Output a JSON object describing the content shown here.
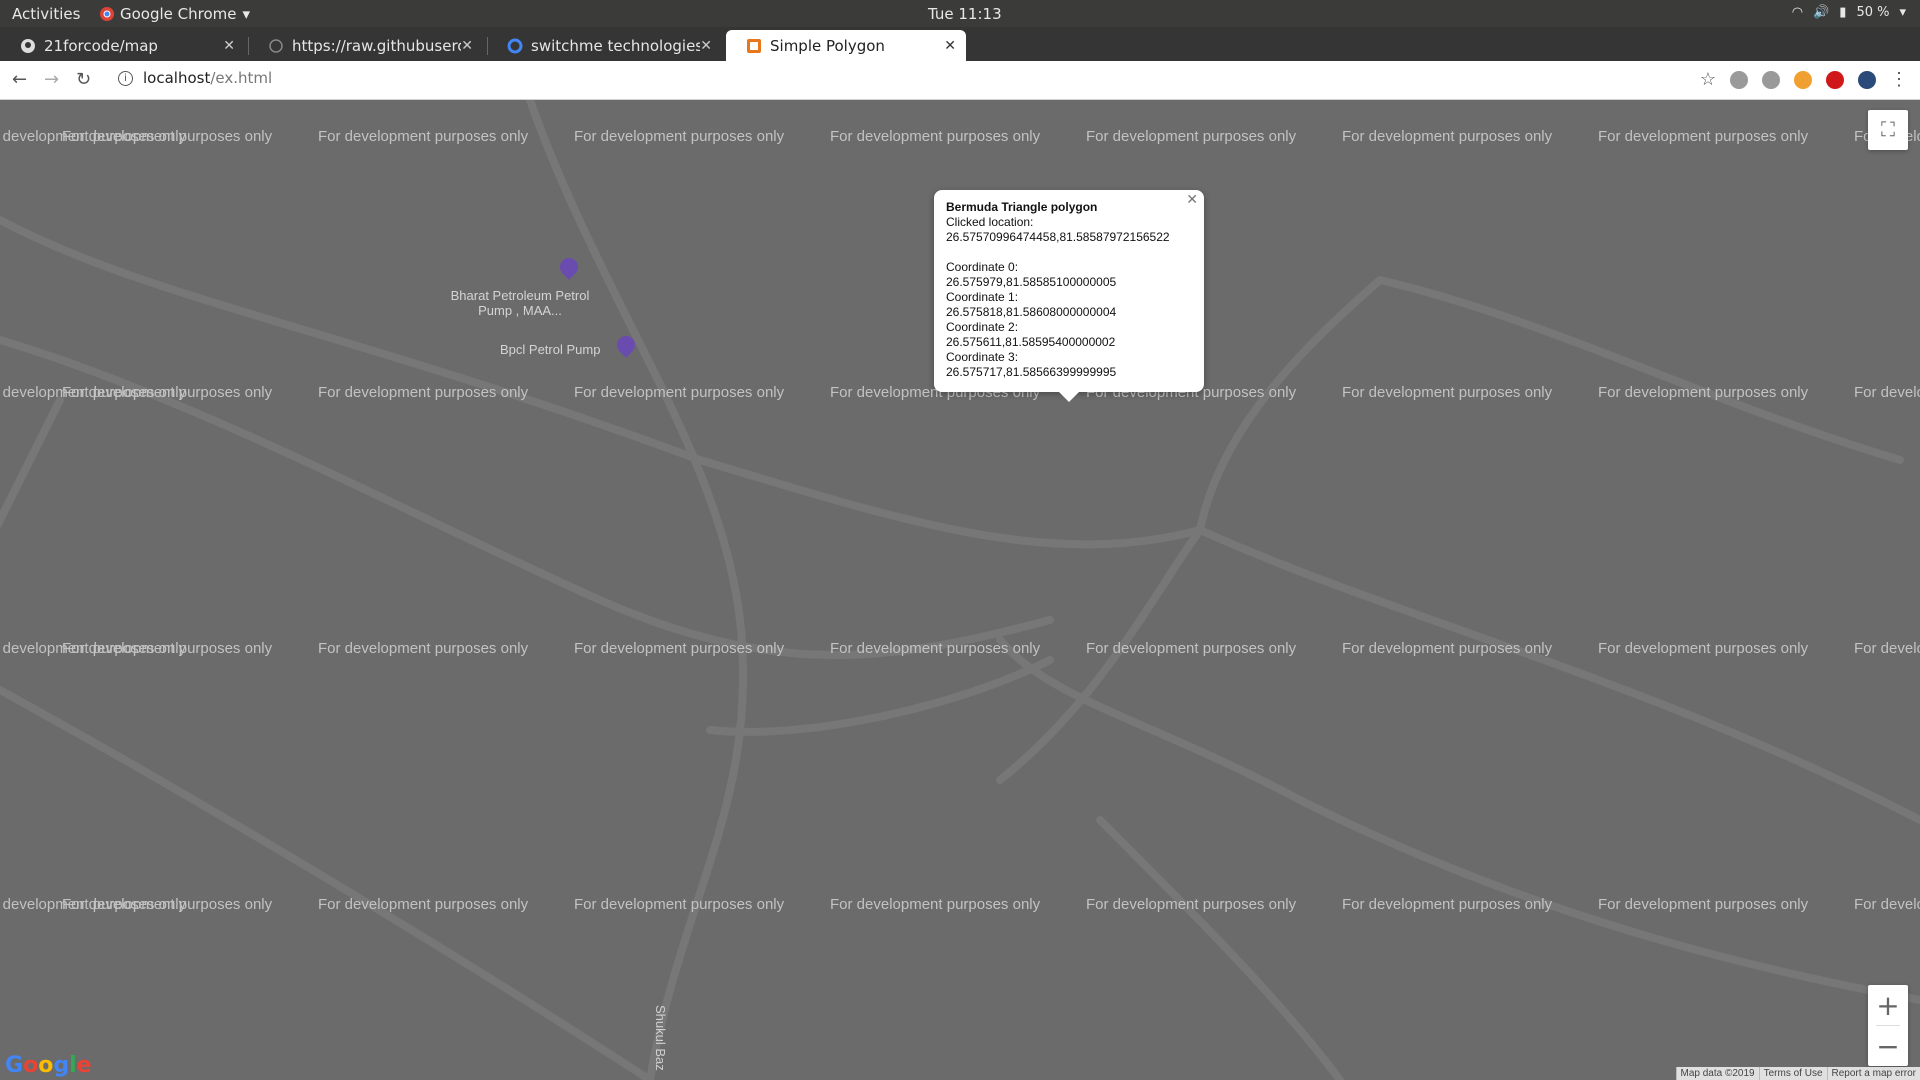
{
  "system_bar": {
    "activities": "Activities",
    "app_name": "Google Chrome",
    "clock": "Tue 11:13",
    "battery": "50 %"
  },
  "tabs": [
    {
      "title": "21forcode/map",
      "icon": "github-icon"
    },
    {
      "title": "https://raw.githubuserco",
      "icon": "globe-icon"
    },
    {
      "title": "switchme technologies - G",
      "icon": "google-icon"
    },
    {
      "title": "Simple Polygon",
      "icon": "polygon-favicon",
      "active": true
    }
  ],
  "toolbar": {
    "url_host": "localhost",
    "url_path": "/ex.html"
  },
  "map": {
    "watermark": "For development purposes only",
    "poi": [
      {
        "name": "Bharat Petroleum Petrol Pump , MAA..."
      },
      {
        "name": "Bpcl Petrol Pump"
      }
    ],
    "road_label": "Shukul Baz",
    "attribution": {
      "map_data": "Map data ©2019",
      "terms": "Terms of Use",
      "report": "Report a map error"
    },
    "zoom_in": "+",
    "zoom_out": "−"
  },
  "info_window": {
    "title": "Bermuda Triangle polygon",
    "clicked_label": "Clicked location:",
    "clicked_value": "26.57570996474458,81.58587972156522",
    "coordinates": [
      {
        "label": "Coordinate 0:",
        "value": "26.575979,81.58585100000005"
      },
      {
        "label": "Coordinate 1:",
        "value": "26.575818,81.58608000000004"
      },
      {
        "label": "Coordinate 2:",
        "value": "26.575611,81.58595400000002"
      },
      {
        "label": "Coordinate 3:",
        "value": "26.575717,81.58566399999995"
      }
    ]
  },
  "colors": {
    "polygon_stroke": "#e01010",
    "map_bg": "#6b6b6b"
  }
}
